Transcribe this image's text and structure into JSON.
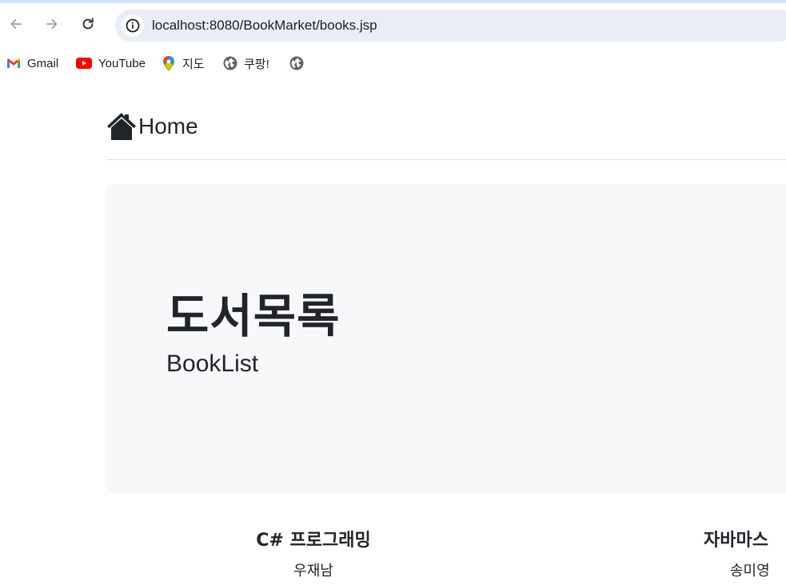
{
  "browser": {
    "url": "localhost:8080/BookMarket/books.jsp",
    "bookmarks": [
      {
        "label": "Gmail",
        "icon": "gmail-icon"
      },
      {
        "label": "YouTube",
        "icon": "youtube-icon"
      },
      {
        "label": "지도",
        "icon": "maps-pin-icon"
      },
      {
        "label": "쿠팡!",
        "icon": "globe-icon"
      },
      {
        "label": "",
        "icon": "globe-icon"
      }
    ]
  },
  "page": {
    "nav_home_label": "Home",
    "jumbotron": {
      "title": "도서목록",
      "subtitle": "BookList"
    },
    "books": [
      {
        "title": "C# 프로그래밍",
        "author": "우재남"
      },
      {
        "title": "자바마스",
        "author": "송미영"
      }
    ]
  },
  "colors": {
    "accent": "#d3e3fd",
    "address_bar": "#e9edf6",
    "jumbotron_bg": "#f7f8fa",
    "text": "#212529",
    "youtube_red": "#ff0000"
  }
}
